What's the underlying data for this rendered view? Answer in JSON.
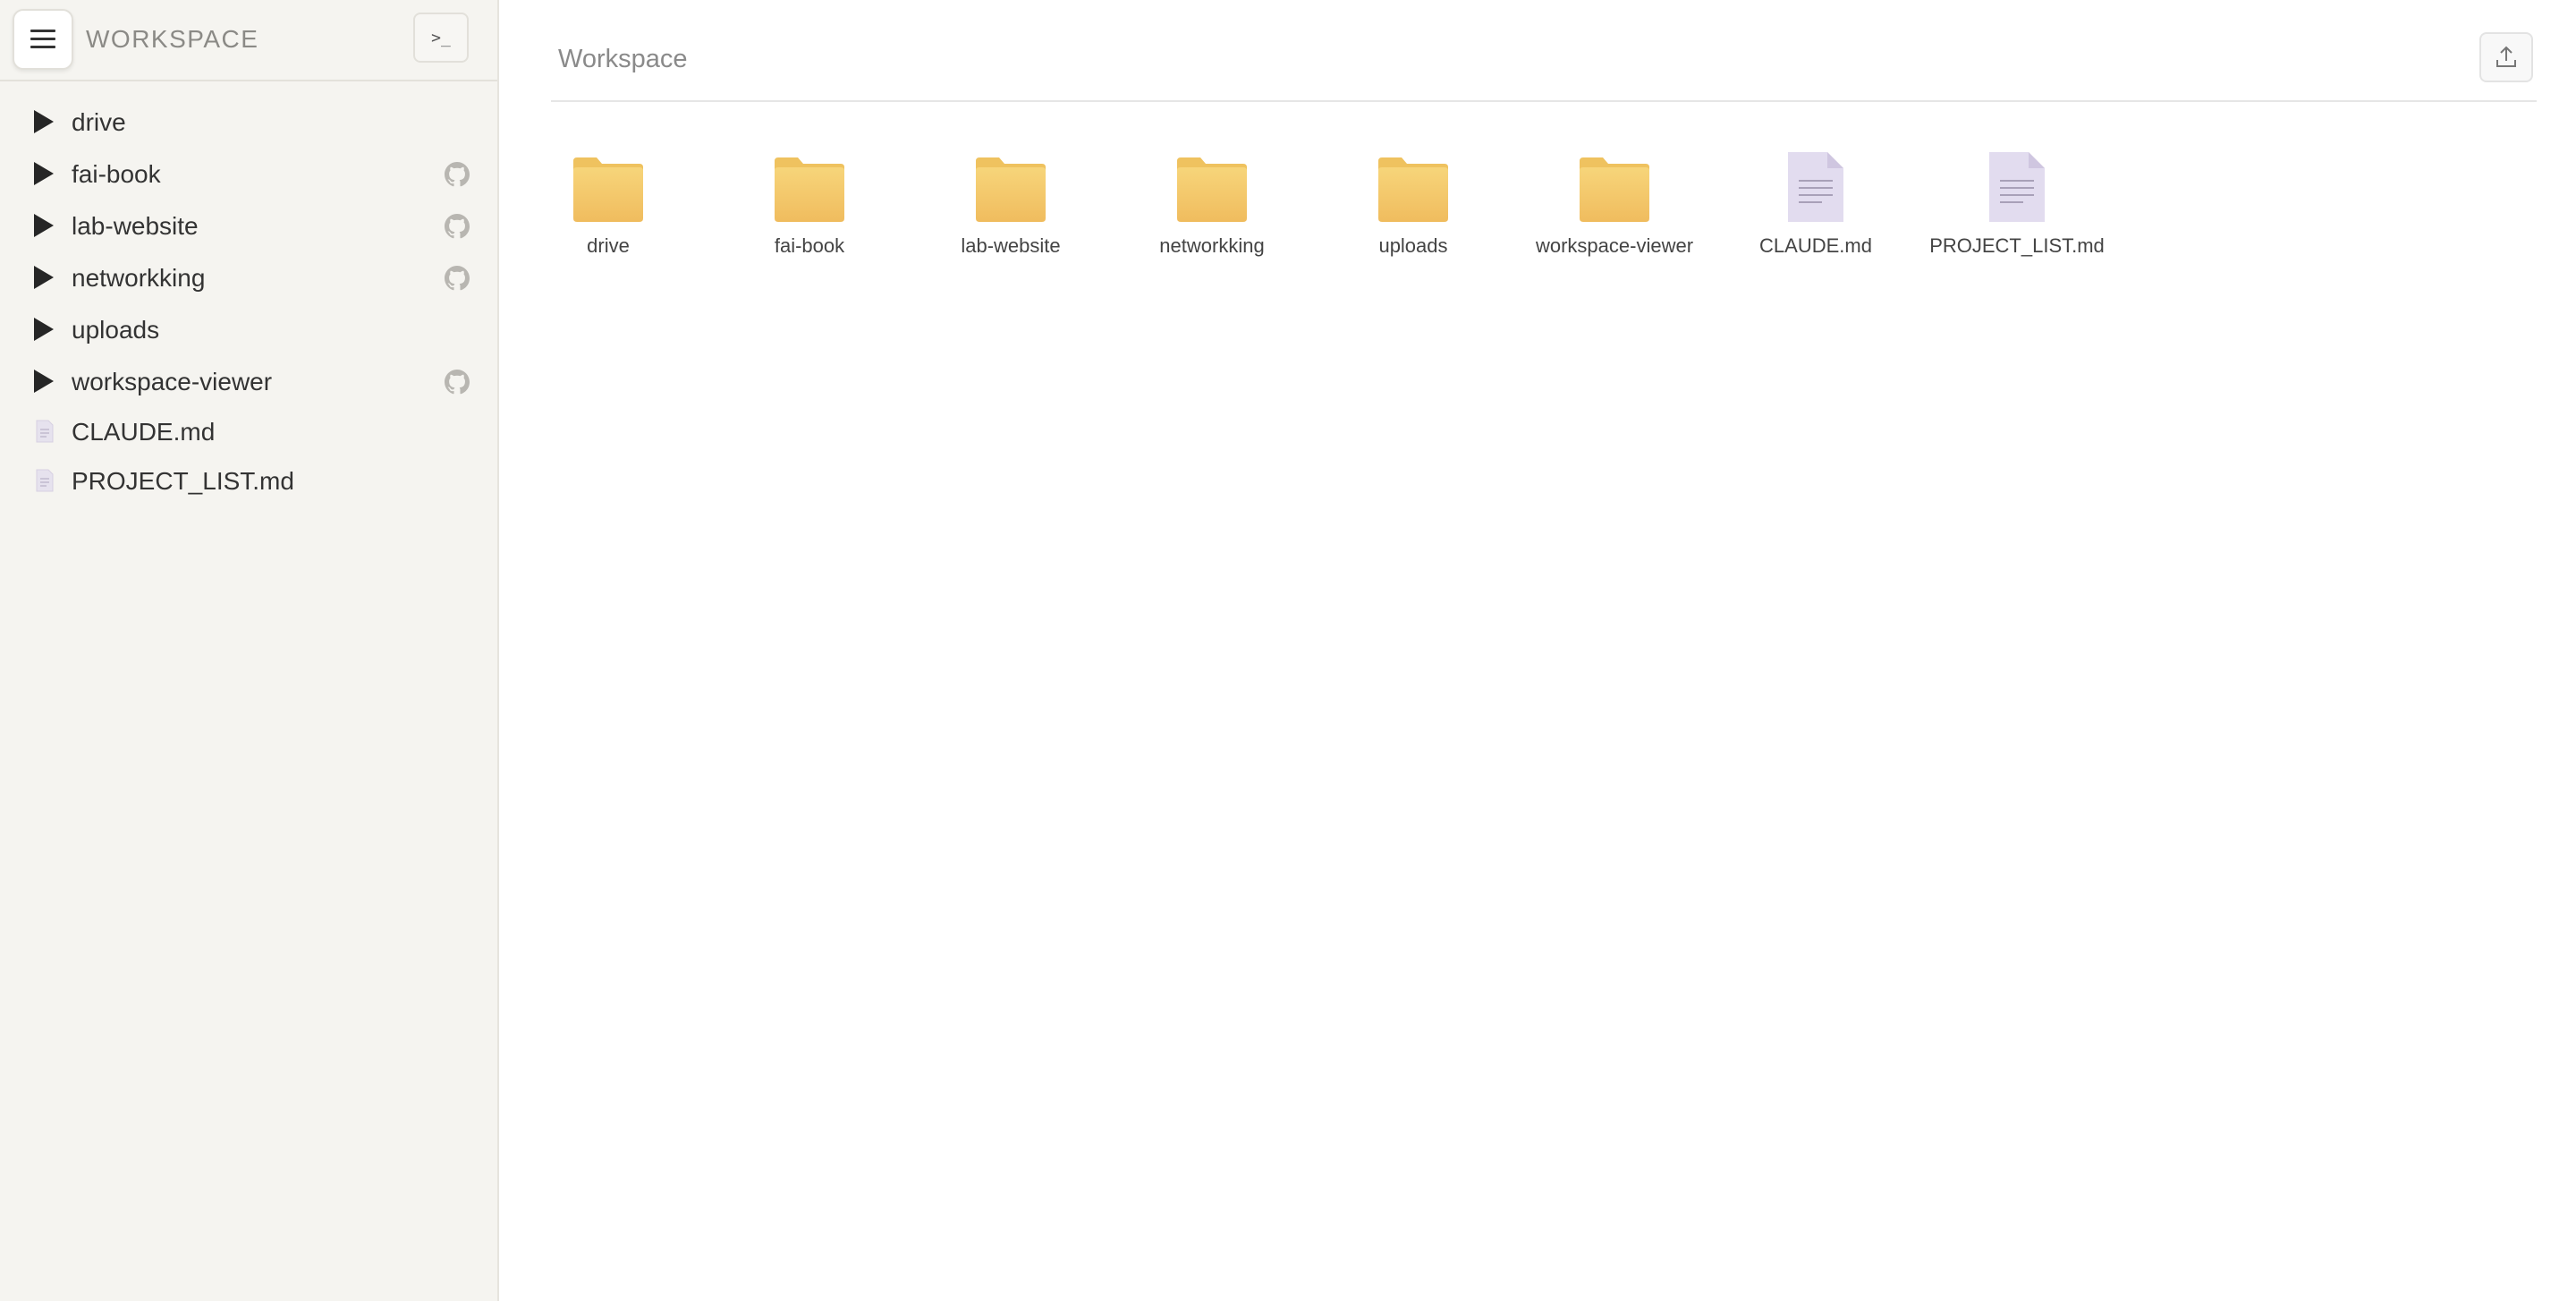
{
  "sidebar": {
    "title": "WORKSPACE",
    "menu_icon": "hamburger-icon",
    "terminal_icon": "terminal-icon",
    "terminal_glyph": ">_",
    "items": [
      {
        "label": "drive",
        "type": "folder",
        "github": false
      },
      {
        "label": "fai-book",
        "type": "folder",
        "github": true
      },
      {
        "label": "lab-website",
        "type": "folder",
        "github": true
      },
      {
        "label": "networkking",
        "type": "folder",
        "github": true
      },
      {
        "label": "uploads",
        "type": "folder",
        "github": false
      },
      {
        "label": "workspace-viewer",
        "type": "folder",
        "github": true
      },
      {
        "label": "CLAUDE.md",
        "type": "file",
        "github": false
      },
      {
        "label": "PROJECT_LIST.md",
        "type": "file",
        "github": false
      }
    ]
  },
  "main": {
    "breadcrumb": "Workspace",
    "upload_icon": "upload-icon",
    "items": [
      {
        "label": "drive",
        "type": "folder"
      },
      {
        "label": "fai-book",
        "type": "folder"
      },
      {
        "label": "lab-website",
        "type": "folder"
      },
      {
        "label": "networkking",
        "type": "folder"
      },
      {
        "label": "uploads",
        "type": "folder"
      },
      {
        "label": "workspace-viewer",
        "type": "folder"
      },
      {
        "label": "CLAUDE.md",
        "type": "file"
      },
      {
        "label": "PROJECT_LIST.md",
        "type": "file"
      }
    ]
  },
  "colors": {
    "folder_top": "#f7d57a",
    "folder_bottom": "#f0bc5e",
    "file_fill": "#e2dcef",
    "sidebar_bg": "#f5f4f0"
  }
}
